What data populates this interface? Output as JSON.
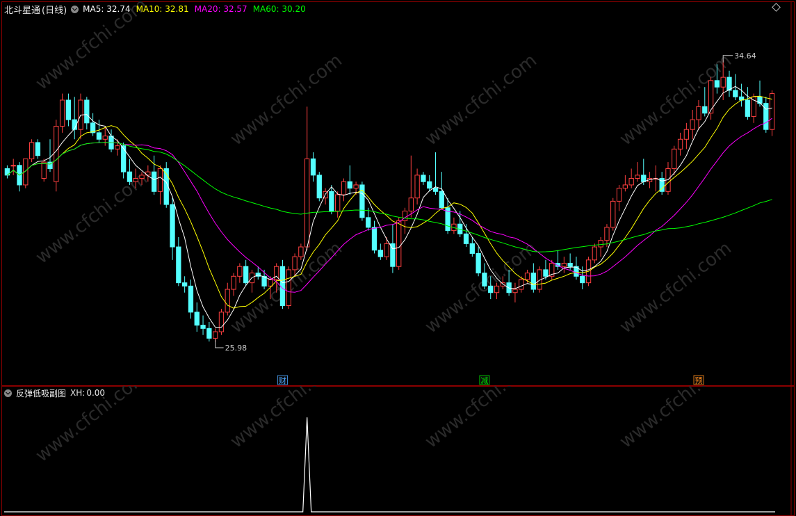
{
  "header": {
    "title": "北斗星通",
    "period": "(日线)",
    "ma": [
      {
        "label": "MA5:",
        "value": "32.74",
        "color": "#ffffff"
      },
      {
        "label": "MA10:",
        "value": "32.81",
        "color": "#ffff00"
      },
      {
        "label": "MA20:",
        "value": "32.57",
        "color": "#ff00ff"
      },
      {
        "label": "MA60:",
        "value": "30.20",
        "color": "#00ff00"
      }
    ]
  },
  "sub_header": {
    "title": "反弹低吸副图",
    "label": "XH:",
    "value": "0.00"
  },
  "markers": [
    {
      "text": "财",
      "color": "#4da6ff",
      "bar_index": 45
    },
    {
      "text": "减",
      "color": "#00e000",
      "bar_index": 78
    },
    {
      "text": "预",
      "color": "#ff8a1a",
      "bar_index": 113
    }
  ],
  "colors": {
    "up": "#ff4040",
    "down": "#54ffff",
    "axis": "#8b0000"
  },
  "watermark": "www.cfchi.com",
  "chart_data": {
    "type": "candlestick",
    "title": "北斗星通 (日线)",
    "ylim": [
      25.0,
      36.0
    ],
    "high_label": "34.64",
    "low_label": "25.98",
    "candles": [
      [
        31.3,
        31.4,
        31.0,
        31.1
      ],
      [
        31.4,
        31.6,
        31.1,
        31.4
      ],
      [
        31.4,
        31.5,
        30.6,
        30.8
      ],
      [
        30.8,
        31.6,
        30.7,
        31.6
      ],
      [
        31.6,
        32.2,
        31.5,
        32.1
      ],
      [
        32.1,
        32.2,
        31.6,
        31.7
      ],
      [
        31.0,
        31.6,
        30.9,
        31.5
      ],
      [
        31.5,
        32.2,
        31.2,
        31.3
      ],
      [
        30.9,
        32.8,
        30.6,
        32.6
      ],
      [
        32.6,
        33.6,
        32.4,
        33.4
      ],
      [
        33.4,
        33.6,
        32.6,
        32.8
      ],
      [
        32.8,
        33.5,
        32.2,
        32.5
      ],
      [
        32.5,
        33.6,
        32.2,
        33.4
      ],
      [
        33.4,
        33.5,
        32.5,
        32.7
      ],
      [
        32.7,
        33.0,
        32.3,
        32.4
      ],
      [
        32.4,
        32.8,
        32.1,
        32.2
      ],
      [
        32.2,
        32.6,
        32.0,
        32.3
      ],
      [
        32.3,
        32.5,
        31.8,
        31.9
      ],
      [
        31.9,
        32.2,
        31.7,
        32.0
      ],
      [
        32.0,
        32.1,
        31.0,
        31.2
      ],
      [
        31.2,
        31.6,
        30.8,
        30.9
      ],
      [
        30.9,
        31.3,
        30.7,
        31.0
      ],
      [
        31.0,
        31.2,
        30.8,
        31.1
      ],
      [
        31.1,
        31.4,
        30.9,
        31.2
      ],
      [
        31.2,
        31.7,
        30.5,
        30.6
      ],
      [
        30.6,
        31.4,
        30.2,
        31.3
      ],
      [
        31.3,
        31.5,
        30.1,
        30.2
      ],
      [
        30.2,
        30.4,
        28.5,
        28.9
      ],
      [
        28.9,
        29.2,
        27.7,
        27.8
      ],
      [
        27.8,
        28.0,
        27.5,
        27.7
      ],
      [
        27.7,
        27.9,
        26.7,
        26.9
      ],
      [
        26.9,
        27.2,
        26.3,
        26.5
      ],
      [
        26.5,
        26.8,
        26.2,
        26.4
      ],
      [
        26.4,
        26.6,
        26.0,
        26.1
      ],
      [
        26.1,
        26.4,
        25.98,
        26.3
      ],
      [
        26.3,
        27.0,
        26.2,
        26.9
      ],
      [
        26.9,
        27.8,
        26.8,
        27.6
      ],
      [
        27.6,
        28.1,
        27.4,
        28.0
      ],
      [
        28.0,
        28.4,
        27.8,
        28.3
      ],
      [
        28.3,
        28.5,
        27.7,
        27.8
      ],
      [
        27.8,
        28.2,
        27.5,
        28.1
      ],
      [
        28.1,
        28.3,
        27.9,
        28.0
      ],
      [
        28.0,
        28.2,
        27.6,
        27.7
      ],
      [
        27.7,
        28.0,
        27.3,
        27.9
      ],
      [
        27.9,
        28.4,
        27.5,
        28.3
      ],
      [
        28.3,
        28.5,
        27.0,
        27.1
      ],
      [
        27.1,
        28.3,
        27.0,
        28.2
      ],
      [
        28.2,
        28.7,
        28.0,
        28.6
      ],
      [
        28.6,
        29.0,
        28.5,
        28.9
      ],
      [
        28.9,
        33.2,
        28.8,
        31.6
      ],
      [
        31.6,
        31.8,
        30.9,
        31.1
      ],
      [
        31.1,
        31.2,
        30.3,
        30.4
      ],
      [
        30.4,
        30.7,
        30.2,
        30.6
      ],
      [
        30.6,
        30.8,
        29.9,
        30.0
      ],
      [
        30.0,
        30.6,
        29.8,
        30.5
      ],
      [
        30.5,
        31.0,
        30.3,
        30.9
      ],
      [
        30.9,
        31.4,
        30.5,
        30.7
      ],
      [
        30.7,
        30.9,
        30.5,
        30.8
      ],
      [
        30.8,
        30.9,
        29.7,
        29.8
      ],
      [
        29.8,
        30.1,
        29.4,
        29.5
      ],
      [
        29.5,
        29.7,
        28.7,
        28.8
      ],
      [
        28.8,
        29.0,
        28.5,
        28.6
      ],
      [
        28.6,
        29.2,
        28.5,
        29.0
      ],
      [
        29.0,
        29.6,
        28.1,
        28.3
      ],
      [
        28.3,
        29.8,
        28.2,
        29.7
      ],
      [
        29.7,
        30.1,
        29.3,
        30.0
      ],
      [
        30.0,
        31.7,
        29.8,
        30.4
      ],
      [
        30.4,
        31.3,
        30.2,
        31.1
      ],
      [
        31.1,
        31.2,
        30.8,
        30.9
      ],
      [
        30.9,
        31.1,
        30.6,
        30.7
      ],
      [
        30.7,
        31.8,
        30.5,
        30.6
      ],
      [
        30.6,
        31.2,
        30.5,
        30.1
      ],
      [
        30.1,
        30.4,
        29.3,
        29.4
      ],
      [
        29.4,
        29.8,
        29.3,
        29.6
      ],
      [
        29.6,
        30.0,
        29.2,
        29.3
      ],
      [
        29.3,
        29.6,
        28.9,
        29.0
      ],
      [
        29.0,
        29.2,
        28.6,
        28.7
      ],
      [
        28.7,
        28.9,
        28.0,
        28.1
      ],
      [
        28.1,
        28.4,
        27.6,
        27.7
      ],
      [
        27.7,
        28.0,
        27.3,
        27.5
      ],
      [
        27.5,
        27.8,
        27.3,
        27.7
      ],
      [
        27.7,
        28.0,
        27.6,
        27.8
      ],
      [
        27.8,
        28.2,
        27.4,
        27.5
      ],
      [
        27.5,
        27.8,
        27.2,
        27.6
      ],
      [
        27.6,
        28.0,
        27.5,
        27.9
      ],
      [
        27.9,
        28.2,
        27.8,
        28.1
      ],
      [
        28.1,
        28.4,
        27.5,
        27.6
      ],
      [
        27.6,
        28.3,
        27.5,
        28.2
      ],
      [
        28.2,
        28.5,
        27.9,
        28.0
      ],
      [
        28.0,
        28.5,
        27.9,
        28.4
      ],
      [
        28.4,
        28.8,
        28.2,
        28.3
      ],
      [
        28.3,
        28.6,
        28.1,
        28.4
      ],
      [
        28.4,
        28.7,
        28.2,
        28.3
      ],
      [
        28.3,
        28.6,
        27.9,
        28.0
      ],
      [
        28.0,
        28.3,
        27.6,
        27.8
      ],
      [
        27.8,
        28.6,
        27.7,
        28.5
      ],
      [
        28.5,
        29.0,
        28.4,
        28.9
      ],
      [
        28.9,
        29.2,
        28.6,
        29.1
      ],
      [
        29.1,
        29.6,
        28.9,
        29.5
      ],
      [
        29.5,
        30.4,
        29.4,
        30.3
      ],
      [
        30.3,
        30.8,
        30.0,
        30.7
      ],
      [
        30.7,
        31.1,
        30.6,
        30.8
      ],
      [
        30.8,
        31.3,
        30.7,
        31.0
      ],
      [
        31.0,
        31.5,
        30.9,
        31.1
      ],
      [
        31.1,
        31.6,
        30.8,
        30.9
      ],
      [
        30.9,
        31.2,
        30.7,
        31.0
      ],
      [
        31.0,
        31.4,
        30.6,
        31.0
      ],
      [
        31.0,
        31.2,
        30.5,
        30.6
      ],
      [
        30.6,
        31.5,
        30.5,
        31.3
      ],
      [
        31.3,
        32.0,
        31.1,
        31.9
      ],
      [
        31.9,
        32.4,
        31.7,
        32.2
      ],
      [
        32.2,
        32.7,
        31.9,
        32.5
      ],
      [
        32.5,
        33.1,
        32.2,
        32.8
      ],
      [
        32.8,
        33.4,
        32.5,
        33.2
      ],
      [
        33.2,
        33.8,
        32.9,
        33.0
      ],
      [
        33.0,
        34.1,
        32.8,
        34.0
      ],
      [
        34.0,
        34.5,
        33.6,
        33.8
      ],
      [
        33.8,
        34.64,
        33.4,
        34.1
      ],
      [
        34.1,
        34.3,
        33.5,
        33.7
      ],
      [
        33.7,
        34.2,
        33.4,
        33.5
      ],
      [
        33.5,
        33.9,
        33.2,
        33.4
      ],
      [
        33.4,
        33.8,
        32.8,
        32.9
      ],
      [
        32.9,
        33.6,
        32.7,
        33.5
      ],
      [
        33.5,
        34.0,
        33.2,
        33.3
      ],
      [
        33.3,
        33.5,
        32.4,
        32.5
      ],
      [
        32.5,
        33.7,
        32.3,
        33.6
      ]
    ],
    "ma_series": [
      {
        "name": "MA5",
        "color": "#ffffff",
        "period": 5
      },
      {
        "name": "MA10",
        "color": "#ffff00",
        "period": 10
      },
      {
        "name": "MA20",
        "color": "#ff00ff",
        "period": 20
      },
      {
        "name": "MA60",
        "color": "#00ff00",
        "period": 60
      }
    ],
    "xh": {
      "spike_index": 49,
      "spike_value": 1,
      "ylim": [
        0,
        1.2
      ]
    }
  }
}
